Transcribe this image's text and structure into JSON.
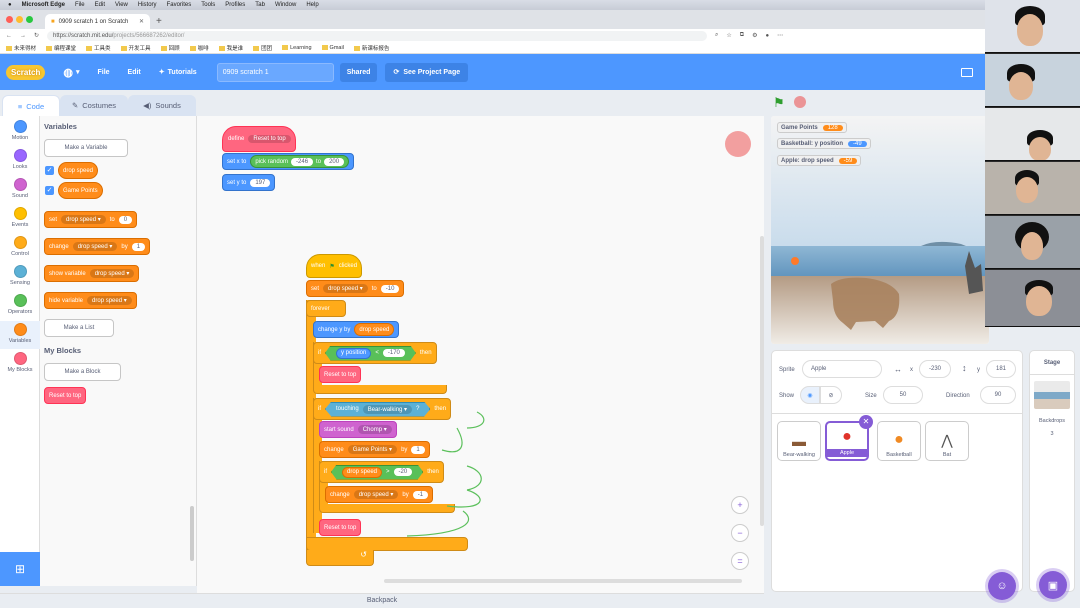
{
  "menubar_mac": {
    "app": "Microsoft Edge",
    "items": [
      "File",
      "Edit",
      "View",
      "History",
      "Favorites",
      "Tools",
      "Profiles",
      "Tab",
      "Window",
      "Help"
    ]
  },
  "browser": {
    "tab_title": "0909 scratch 1 on Scratch",
    "url_prefix": "https://scratch.mit.edu/",
    "url_path": "projects/566687262/editor/",
    "bookmarks": [
      "未来得材",
      "编程课堂",
      "工具类",
      "开发工具",
      "回顾",
      "咖啡",
      "我是谁",
      "团团",
      "Learning",
      "Gmail",
      "新课标报告"
    ]
  },
  "scratch_menu": {
    "logo": "Scratch",
    "file": "File",
    "edit": "Edit",
    "tutorials": "Tutorials",
    "project_title": "0909 scratch 1",
    "shared": "Shared",
    "see_project_page": "See Project Page"
  },
  "editor_tabs": {
    "code": "Code",
    "costumes": "Costumes",
    "sounds": "Sounds"
  },
  "categories": [
    {
      "label": "Motion",
      "color": "#4c97ff"
    },
    {
      "label": "Looks",
      "color": "#9966ff"
    },
    {
      "label": "Sound",
      "color": "#cf63cf"
    },
    {
      "label": "Events",
      "color": "#ffbf00"
    },
    {
      "label": "Control",
      "color": "#ffab19"
    },
    {
      "label": "Sensing",
      "color": "#5cb1d6"
    },
    {
      "label": "Operators",
      "color": "#59c059"
    },
    {
      "label": "Variables",
      "color": "#ff8c1a"
    },
    {
      "label": "My Blocks",
      "color": "#ff6680"
    }
  ],
  "palette": {
    "variables_header": "Variables",
    "make_variable": "Make a Variable",
    "var1": "drop speed",
    "var2": "Game Points",
    "set_block": {
      "a": "set",
      "b": "drop speed",
      "c": "to",
      "d": "0"
    },
    "change_block": {
      "a": "change",
      "b": "drop speed",
      "c": "by",
      "d": "1"
    },
    "show_block": {
      "a": "show variable",
      "b": "drop speed"
    },
    "hide_block": {
      "a": "hide variable",
      "b": "drop speed"
    },
    "make_list": "Make a List",
    "myblocks_header": "My Blocks",
    "make_block": "Make a Block",
    "reset_block": "Reset to top"
  },
  "script1": {
    "define": "define",
    "define_name": "Reset to top",
    "setx": "set x to",
    "pick_random": "pick random",
    "r_from": "-246",
    "r_to": "to",
    "r_to_val": "200",
    "sety": "set y to",
    "sety_val": "197"
  },
  "script2": {
    "when_flag": "when",
    "clicked": "clicked",
    "set": "set",
    "set_var": "drop speed",
    "set_to": "to",
    "set_val": "-10",
    "forever": "forever",
    "change_y": "change y by",
    "change_y_var": "drop speed",
    "if1": "if",
    "ypos": "y position",
    "lt": "<",
    "lt_val": "-170",
    "then": "then",
    "reset1": "Reset to top",
    "if2": "if",
    "touching": "touching",
    "touching_obj": "Bear-walking",
    "q": "?",
    "then2": "then",
    "start_sound": "start sound",
    "sound_name": "Chomp",
    "change_gp": "change",
    "gp_var": "Game Points",
    "gp_by": "by",
    "gp_val": "1",
    "if3": "if",
    "ds_var": "drop speed",
    "gt": ">",
    "gt_val": "-20",
    "then3": "then",
    "change_ds": "change",
    "ds_var2": "drop speed",
    "ds_by": "by",
    "ds_val": "-1",
    "reset2": "Reset to top"
  },
  "zoom": {
    "in": "+",
    "out": "−",
    "reset": "="
  },
  "backpack": "Backpack",
  "monitors": [
    {
      "label": "Game Points",
      "value": "128"
    },
    {
      "label": "Basketball: y position",
      "value": "-49"
    },
    {
      "label": "Apple: drop speed",
      "value": "-59"
    }
  ],
  "sprite_info": {
    "sprite_label": "Sprite",
    "sprite_name": "Apple",
    "x_label": "x",
    "x_val": "-230",
    "y_label": "y",
    "y_val": "181",
    "show_label": "Show",
    "size_label": "Size",
    "size_val": "50",
    "direction_label": "Direction",
    "direction_val": "90"
  },
  "sprites": [
    {
      "name": "Bear-walking"
    },
    {
      "name": "Apple"
    },
    {
      "name": "Basketball"
    },
    {
      "name": "Bat"
    }
  ],
  "stage_panel": {
    "title": "Stage",
    "backdrops_label": "Backdrops",
    "backdrops_count": "3"
  }
}
